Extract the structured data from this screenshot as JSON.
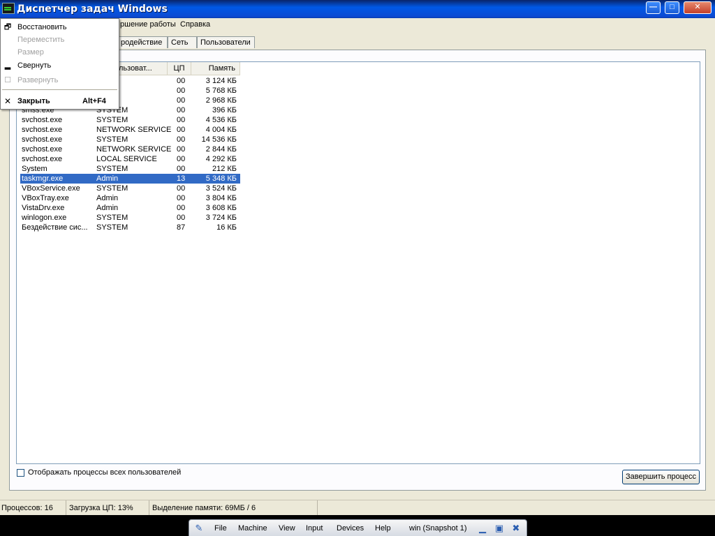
{
  "window": {
    "title": "Диспетчер задач Windows",
    "buttons": {
      "minimize": "—",
      "maximize": "□",
      "close": "✕"
    }
  },
  "menubar": {
    "items": [
      "ршение работы",
      "Справка"
    ]
  },
  "tabs": [
    "родействие",
    "Сеть",
    "Пользователи"
  ],
  "table": {
    "columns": [
      "льзоват...",
      "ЦП",
      "Память"
    ],
    "rows": [
      {
        "name": "",
        "user": "",
        "cpu": "00",
        "mem": "3 124 КБ"
      },
      {
        "name": "",
        "user": "",
        "cpu": "00",
        "mem": "5 768 КБ"
      },
      {
        "name": "",
        "user": "",
        "cpu": "00",
        "mem": "2 968 КБ"
      },
      {
        "name": "smss.exe",
        "user": "SYSTEM",
        "cpu": "00",
        "mem": "396 КБ"
      },
      {
        "name": "svchost.exe",
        "user": "SYSTEM",
        "cpu": "00",
        "mem": "4 536 КБ"
      },
      {
        "name": "svchost.exe",
        "user": "NETWORK SERVICE",
        "cpu": "00",
        "mem": "4 004 КБ"
      },
      {
        "name": "svchost.exe",
        "user": "SYSTEM",
        "cpu": "00",
        "mem": "14 536 КБ"
      },
      {
        "name": "svchost.exe",
        "user": "NETWORK SERVICE",
        "cpu": "00",
        "mem": "2 844 КБ"
      },
      {
        "name": "svchost.exe",
        "user": "LOCAL SERVICE",
        "cpu": "00",
        "mem": "4 292 КБ"
      },
      {
        "name": "System",
        "user": "SYSTEM",
        "cpu": "00",
        "mem": "212 КБ"
      },
      {
        "name": "taskmgr.exe",
        "user": "Admin",
        "cpu": "13",
        "mem": "5 348 КБ",
        "selected": true
      },
      {
        "name": "VBoxService.exe",
        "user": "SYSTEM",
        "cpu": "00",
        "mem": "3 524 КБ"
      },
      {
        "name": "VBoxTray.exe",
        "user": "Admin",
        "cpu": "00",
        "mem": "3 804 КБ"
      },
      {
        "name": "VistaDrv.exe",
        "user": "Admin",
        "cpu": "00",
        "mem": "3 608 КБ"
      },
      {
        "name": "winlogon.exe",
        "user": "SYSTEM",
        "cpu": "00",
        "mem": "3 724 КБ"
      },
      {
        "name": "Бездействие сис...",
        "user": "SYSTEM",
        "cpu": "87",
        "mem": "16 КБ"
      }
    ]
  },
  "show_all_label": "Отображать процессы всех пользователей",
  "end_process_label": "Завершить процесс",
  "status": {
    "processes": "Процессов: 16",
    "cpu": "Загрузка ЦП: 13%",
    "memory": "Выделение памяти: 69МБ / 6"
  },
  "sysmenu": {
    "items": [
      {
        "label": "Восстановить",
        "icon": "restore-icon",
        "disabled": false
      },
      {
        "label": "Переместить",
        "disabled": true
      },
      {
        "label": "Размер",
        "disabled": true
      },
      {
        "label": "Свернуть",
        "icon": "minimize-icon",
        "disabled": false
      },
      {
        "label": "Развернуть",
        "icon": "maximize-icon",
        "disabled": true
      },
      {
        "label": "Закрыть",
        "shortcut": "Alt+F4",
        "icon": "close-icon",
        "disabled": false,
        "bold": true
      }
    ]
  },
  "vbox": {
    "menu": [
      "File",
      "Machine",
      "View",
      "Input",
      "Devices",
      "Help"
    ],
    "vm_name": "win (Snapshot 1)"
  },
  "colors": {
    "selection": "#316AC5",
    "titlebar": "#0058E6"
  }
}
